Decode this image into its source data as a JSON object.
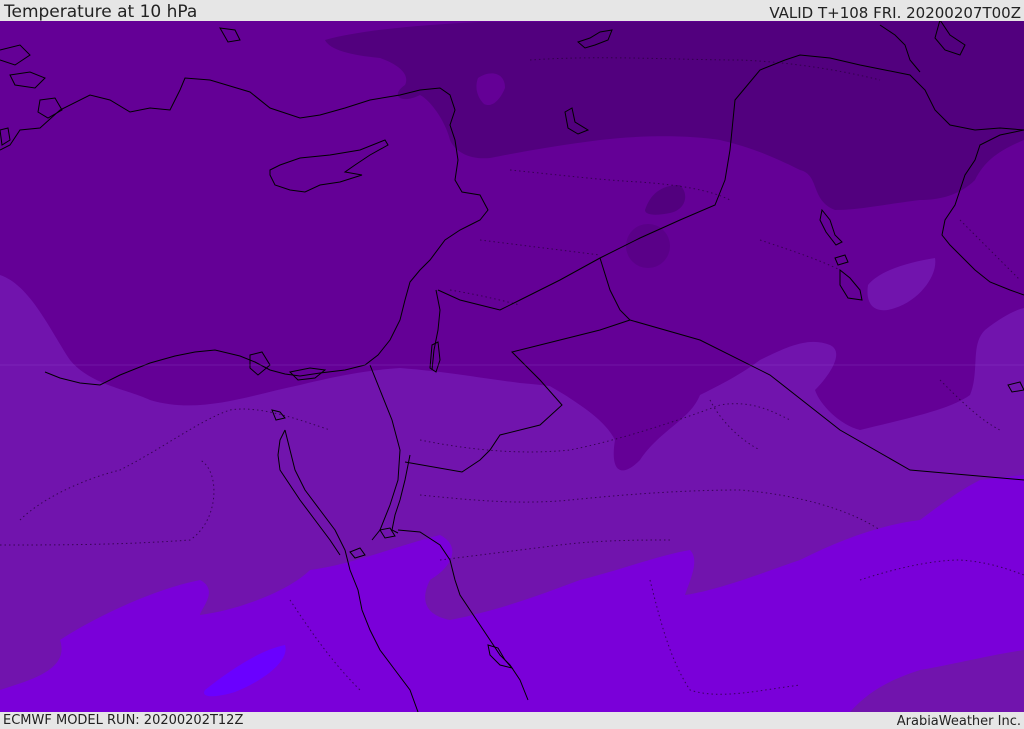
{
  "header": {
    "title": "Temperature at 10 hPa",
    "valid": "VALID T+108 FRI. 20200207T00Z"
  },
  "footer": {
    "model_run": "ECMWF MODEL RUN: 20200202T12Z",
    "credit": "ArabiaWeather Inc."
  },
  "map": {
    "field": "temperature",
    "level": "10 hPa",
    "palette": {
      "darkest": "#52007e",
      "dark": "#640096",
      "mid": "#7114ad",
      "bright": "#7a00d9",
      "brightest": "#6a00ff"
    },
    "coastline_color": "#000000"
  }
}
